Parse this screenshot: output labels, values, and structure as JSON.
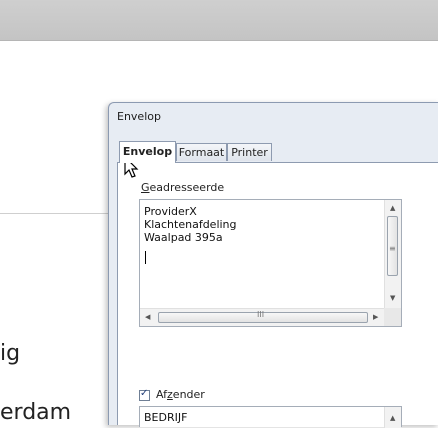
{
  "document": {
    "line1": "ig",
    "line2": "erdam"
  },
  "dialog": {
    "title": "Envelop",
    "tabs": [
      {
        "label": "Envelop",
        "active": true
      },
      {
        "label": "Formaat",
        "active": false
      },
      {
        "label": "Printer",
        "active": false
      }
    ],
    "addressee": {
      "label_accel": "G",
      "label_rest": "eadresseerde",
      "lines": [
        "ProviderX",
        "Klachtenafdeling",
        "Waalpad 395a"
      ]
    },
    "sender": {
      "checked": true,
      "label_pre": "Af",
      "label_accel": "z",
      "label_post": "ender",
      "lines": [
        "BEDRIJF"
      ]
    }
  },
  "icons": {
    "scroll_up": "▲",
    "scroll_down": "▼",
    "scroll_left": "◀",
    "scroll_right": "▶",
    "grip_v": "≡",
    "grip_h": "III",
    "check": "✓"
  },
  "colors": {
    "dialog_bg": "#e7ecf3",
    "border": "#8e9bb0",
    "topbar": "#c8c8c8"
  }
}
